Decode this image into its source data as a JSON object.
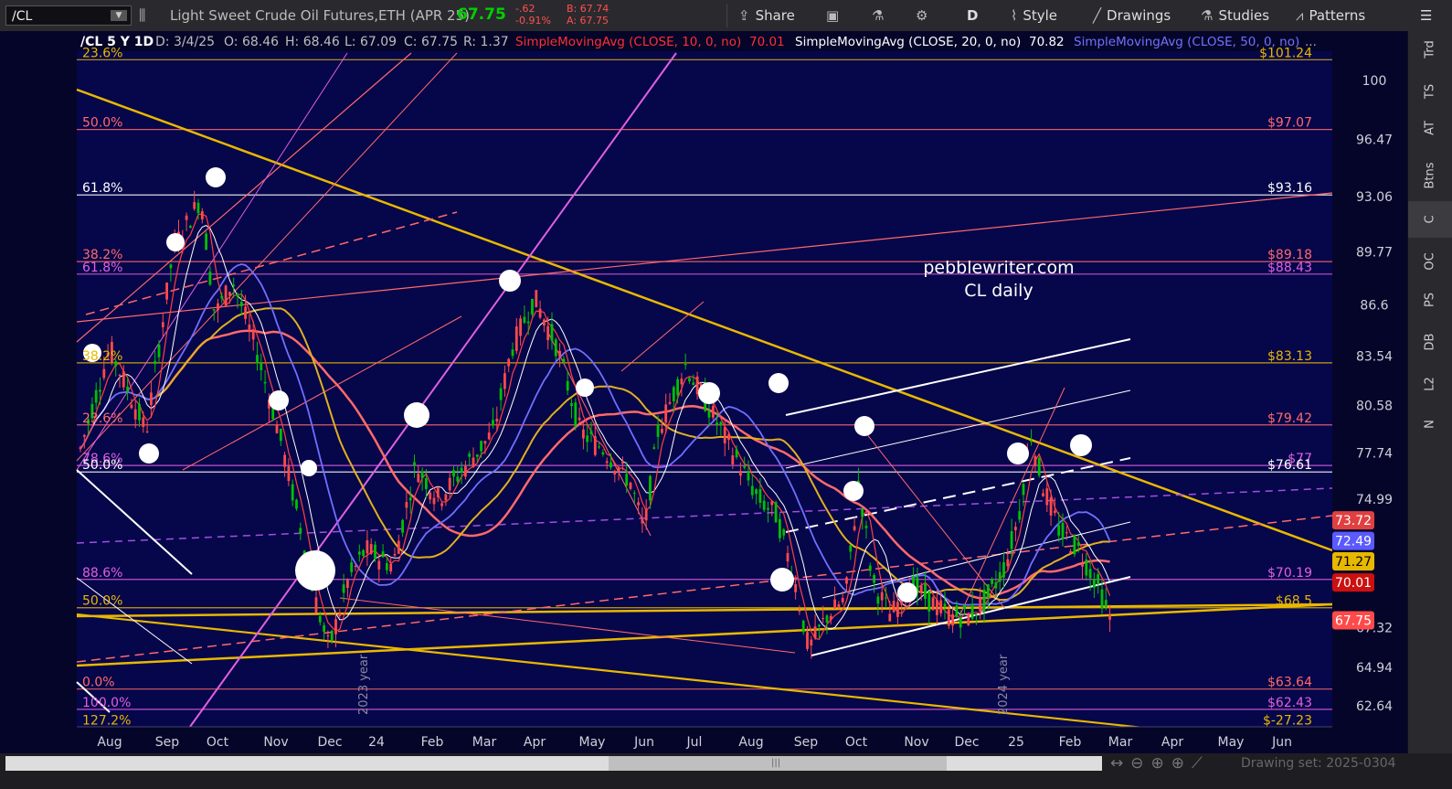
{
  "toolbar": {
    "symbol": "/CL",
    "description": "Light Sweet Crude Oil Futures,ETH (APR 25)",
    "last_price": "67.75",
    "net_change": "-.62",
    "pct_change": "-0.91%",
    "bid": "B: 67.74",
    "ask": "A: 67.75",
    "share_label": "Share",
    "aggregation": "D",
    "style_label": "Style",
    "drawings_label": "Drawings",
    "studies_label": "Studies",
    "patterns_label": "Patterns"
  },
  "header": {
    "chart_id": "/CL 5 Y 1D",
    "date": "D: 3/4/25",
    "open": "O: 68.46",
    "high": "H: 68.46",
    "low": "L: 67.09",
    "close": "C: 67.75",
    "range": "R: 1.37",
    "sma10_label": "SimpleMovingAvg (CLOSE, 10, 0, no)",
    "sma10_value": "70.01",
    "sma20_label": "SimpleMovingAvg (CLOSE, 20, 0, no)",
    "sma20_value": "70.82",
    "sma50_label": "SimpleMovingAvg (CLOSE, 50, 0, no)",
    "more": "..."
  },
  "watermark": {
    "line1": "pebblewriter.com",
    "line2": "CL daily"
  },
  "right_tabs": [
    "Trd",
    "TS",
    "AT",
    "Btns",
    "C",
    "OC",
    "PS",
    "DB",
    "L2",
    "N"
  ],
  "right_tab_active": "C",
  "bottom": {
    "drawing_set": "Drawing set: 2025-0304"
  },
  "colors": {
    "background": "#05052a",
    "up_candle": "#00c000",
    "down_candle": "#ff4a4a",
    "sma10": "#ff4040",
    "sma20": "#ffffff",
    "sma50": "#6f6fff",
    "sma200": "#ff6a6a",
    "sma100": "#e0b020",
    "trendline_gold": "#e8b800",
    "fib_magenta": "#e060e0",
    "price_green": "#00d000"
  },
  "chart_data": {
    "type": "candlestick",
    "title": "/CL 5 Y 1D",
    "ylim": [
      61.3,
      101.2
    ],
    "x_tick_labels": [
      "Aug",
      "Sep",
      "Oct",
      "Nov",
      "Dec",
      "24",
      "Feb",
      "Mar",
      "Apr",
      "May",
      "Jun",
      "Jul",
      "Aug",
      "Sep",
      "Oct",
      "Nov",
      "Dec",
      "25",
      "Feb",
      "Mar",
      "Apr",
      "May",
      "Jun"
    ],
    "y_tick_labels": [
      100,
      96.47,
      93.06,
      89.77,
      86.6,
      83.54,
      80.58,
      77.74,
      74.99,
      64.94,
      62.64
    ],
    "year_markers": [
      "2023 year",
      "2024 year"
    ],
    "fib_levels_left": [
      {
        "label": "23.6%",
        "color": "#e8b800"
      },
      {
        "label": "50.0%",
        "color": "#ff6a6a"
      },
      {
        "label": "61.8%",
        "color": "#ffffff"
      },
      {
        "label": "38.2%",
        "color": "#ff6a6a"
      },
      {
        "label": "61.8%",
        "color": "#e060e0"
      },
      {
        "label": "38.2%",
        "color": "#e8b800"
      },
      {
        "label": "23.6%",
        "color": "#ff6a6a"
      },
      {
        "label": "78.6%",
        "color": "#e060e0"
      },
      {
        "label": "50.0%",
        "color": "#ffffff"
      },
      {
        "label": "88.6%",
        "color": "#e060e0"
      },
      {
        "label": "50.0%",
        "color": "#e8b800"
      },
      {
        "label": "0.0%",
        "color": "#ff6a6a"
      },
      {
        "label": "100.0%",
        "color": "#e060e0"
      },
      {
        "label": "127.2%",
        "color": "#e8b800"
      }
    ],
    "fib_levels_right": [
      {
        "label": "$101.24",
        "value": 101.24,
        "color": "#e8b800"
      },
      {
        "label": "$97.07",
        "value": 97.07,
        "color": "#ff6a6a"
      },
      {
        "label": "$93.16",
        "value": 93.16,
        "color": "#ffffff"
      },
      {
        "label": "$89.18",
        "value": 89.18,
        "color": "#ff6a6a"
      },
      {
        "label": "$88.43",
        "value": 88.43,
        "color": "#e060e0"
      },
      {
        "label": "$83.13",
        "value": 83.13,
        "color": "#e8b800"
      },
      {
        "label": "$79.42",
        "value": 79.42,
        "color": "#ff6a6a"
      },
      {
        "label": "$77",
        "value": 77.0,
        "color": "#e060e0"
      },
      {
        "label": "$76.61",
        "value": 76.61,
        "color": "#ffffff"
      },
      {
        "label": "$70.19",
        "value": 70.19,
        "color": "#e060e0"
      },
      {
        "label": "$68.5",
        "value": 68.5,
        "color": "#e8b800"
      },
      {
        "label": "$63.64",
        "value": 63.64,
        "color": "#ff6a6a"
      },
      {
        "label": "$62.43",
        "value": 62.43,
        "color": "#e060e0"
      },
      {
        "label": "$-27.23",
        "value": 61.35,
        "color": "#e8b800"
      }
    ],
    "price_badges": [
      {
        "label": "73.72",
        "value": 73.72,
        "bg": "#e04040",
        "fg": "#ffffff"
      },
      {
        "label": "72.49",
        "value": 72.49,
        "bg": "#5a5aff",
        "fg": "#ffffff"
      },
      {
        "label": "71.27",
        "value": 71.27,
        "bg": "#e8b800",
        "fg": "#000000"
      },
      {
        "label": "70.01",
        "value": 70.01,
        "bg": "#cc1010",
        "fg": "#ffffff"
      },
      {
        "label": "67.75",
        "value": 67.75,
        "bg": "#ff4a4a",
        "fg": "#ffffff"
      }
    ],
    "grid": false
  }
}
